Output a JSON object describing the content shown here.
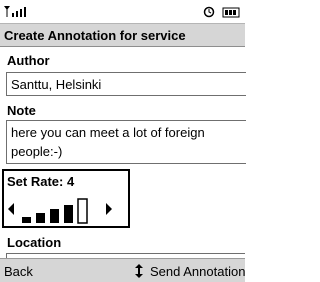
{
  "status": {
    "signal_icon": "signal-strength-icon",
    "right_icons": [
      "alarm-icon",
      "battery-icon"
    ]
  },
  "title": "Create Annotation for service",
  "author": {
    "label": "Author",
    "value": "Santtu, Helsinki"
  },
  "note": {
    "label": "Note",
    "value_line1": "here you can meet a lot of foreign",
    "value_line2": "people:-)"
  },
  "rate": {
    "label": "Set Rate: 4",
    "value": 4,
    "max": 5
  },
  "location": {
    "label": "Location"
  },
  "softkeys": {
    "left": "Back",
    "right": "Send Annotation",
    "right_icon": "up-down-arrow-icon"
  }
}
